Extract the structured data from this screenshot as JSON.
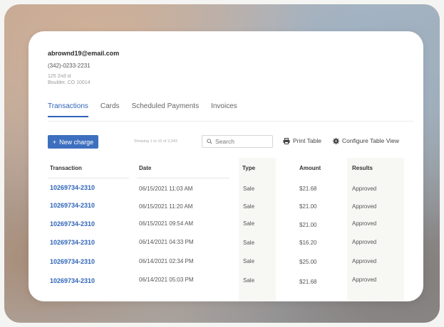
{
  "contact": {
    "email": "abrownd19@email.com",
    "phone": "(342)-0233-2231",
    "address_line1": "125 2nd st",
    "address_line2": "Boulder, CO 10014"
  },
  "tabs": [
    {
      "label": "Transactions",
      "active": true
    },
    {
      "label": "Cards",
      "active": false
    },
    {
      "label": "Scheduled Payments",
      "active": false
    },
    {
      "label": "Invoices",
      "active": false
    }
  ],
  "toolbar": {
    "new_charge_label": "New charge",
    "showing_text": "Showing 1 to 10 of 2,043",
    "search_placeholder": "Search",
    "print_label": "Print Table",
    "configure_label": "Configure Table View"
  },
  "table": {
    "headers": [
      "Transaction",
      "Date",
      "Type",
      "Amount",
      "Results"
    ],
    "rows": [
      [
        "10269734-2310",
        "06/15/2021 11:03 AM",
        "Sale",
        "$21.68",
        "Approved"
      ],
      [
        "10269734-2310",
        "06/15/2021 11:20 AM",
        "Sale",
        "$21.00",
        "Approved"
      ],
      [
        "10269734-2310",
        "06/15/2021 09:54 AM",
        "Sale",
        "$21.00",
        "Approved"
      ],
      [
        "10269734-2310",
        "06/14/2021 04:33 PM",
        "Sale",
        "$16.20",
        "Approved"
      ],
      [
        "10269734-2310",
        "06/14/2021 02:34 PM",
        "Sale",
        "$25.00",
        "Approved"
      ],
      [
        "10269734-2310",
        "06/14/2021 05:03 PM",
        "Sale",
        "$21.68",
        "Approved"
      ]
    ]
  },
  "colors": {
    "accent": "#2f64b8",
    "button": "#3d6fbf",
    "shaded_column": "#f7f7f4"
  }
}
